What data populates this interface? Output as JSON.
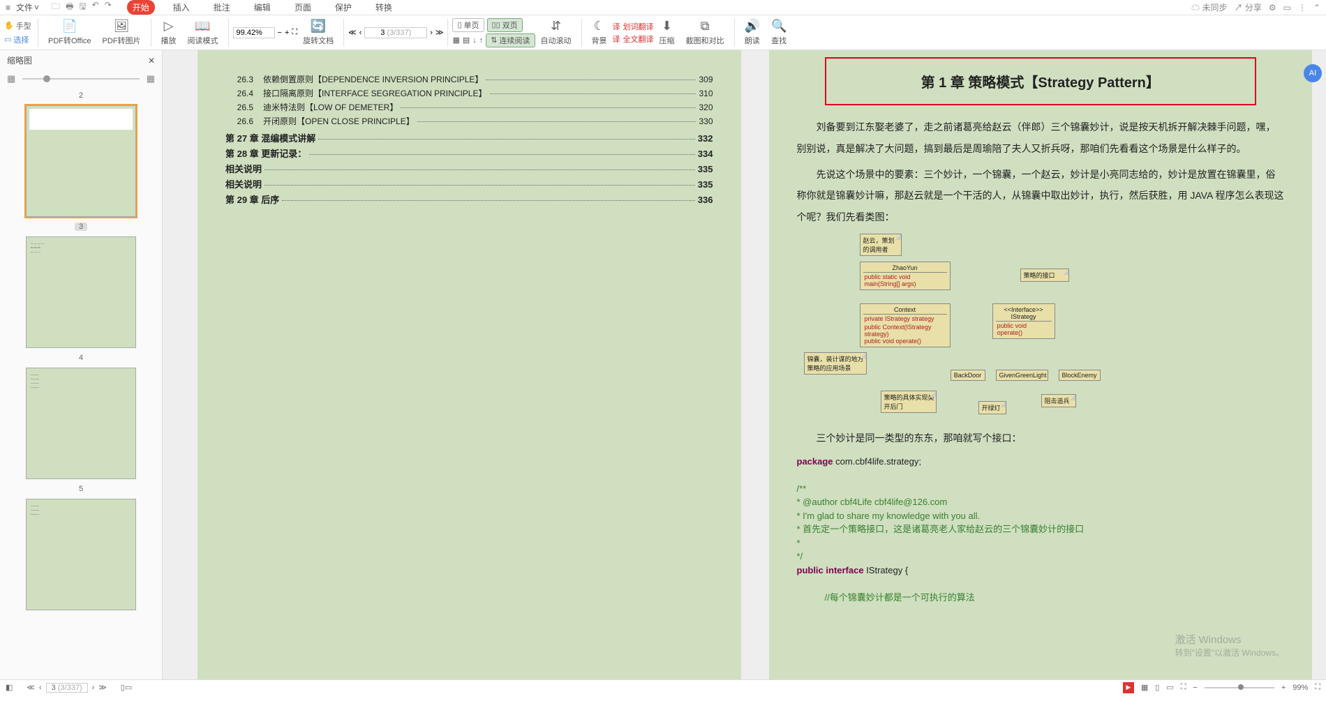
{
  "menu": {
    "file": "文件",
    "tabs": [
      "开始",
      "插入",
      "批注",
      "编辑",
      "页面",
      "保护",
      "转换"
    ],
    "right": {
      "unsync": "未同步",
      "share": "分享"
    }
  },
  "ribbon": {
    "mode_hand": "手型",
    "mode_select": "选择",
    "pdf_office": "PDF转Office",
    "pdf_img": "PDF转图片",
    "play": "播放",
    "read": "阅读模式",
    "zoom": "99.42%",
    "rotate": "旋转文档",
    "page_current": "3",
    "page_total": "(3/337)",
    "single": "单页",
    "double": "双页",
    "continuous": "连续阅读",
    "autoscroll": "自动滚动",
    "bg": "背景",
    "stamp": "全文翻译",
    "wordtrans": "划词翻译",
    "compress": "压缩",
    "screenshot": "截图和对比",
    "read_aloud": "朗读",
    "find": "查找"
  },
  "sidebar": {
    "title": "缩略图",
    "pages": [
      "2",
      "3",
      "4",
      "5"
    ]
  },
  "toc": {
    "items": [
      {
        "num": "26.3",
        "title": "依赖倒置原则【DEPENDENCE INVERSION PRINCIPLE】",
        "page": "309"
      },
      {
        "num": "26.4",
        "title": "接口隔离原则【INTERFACE SEGREGATION PRINCIPLE】",
        "page": "310"
      },
      {
        "num": "26.5",
        "title": "迪米特法则【LOW OF DEMETER】",
        "page": "320"
      },
      {
        "num": "26.6",
        "title": "开闭原则【OPEN CLOSE PRINCIPLE】",
        "page": "330"
      }
    ],
    "chapters": [
      {
        "label": "第 27 章   混编模式讲解",
        "page": "332"
      },
      {
        "label": "第 28 章   更新记录：",
        "page": "334"
      },
      {
        "label": "相关说明",
        "page": "335"
      },
      {
        "label": "相关说明",
        "page": "335"
      },
      {
        "label": "第 29 章   后序",
        "page": "336"
      }
    ]
  },
  "chapter": {
    "title": "第 1 章   策略模式【Strategy Pattern】",
    "p1": "刘备要到江东娶老婆了，走之前诸葛亮给赵云（伴郎）三个锦囊妙计，说是按天机拆开解决棘手问题，嘿，别别说，真是解决了大问题，搞到最后是周瑜陪了夫人又折兵呀，那咱们先看看这个场景是什么样子的。",
    "p2": "先说这个场景中的要素：三个妙计，一个锦囊，一个赵云，妙计是小亮同志给的，妙计是放置在锦囊里，俗称你就是锦囊妙计嘛，那赵云就是一个干活的人，从锦囊中取出妙计，执行，然后获胜，用 JAVA 程序怎么表现这个呢？我们先看类图：",
    "p3": "三个妙计是同一类型的东东，那咱就写个接口：",
    "code": {
      "l1": "package",
      "l1b": " com.cbf4life.strategy;",
      "l2": "/**",
      "l3": " * @author cbf4Life cbf4life@126.com",
      "l4": " * I'm glad to share my knowledge with you all.",
      "l5": " * 首先定一个策略接口，这是诸葛亮老人家给赵云的三个锦囊妙计的接口",
      "l6": " *",
      "l7": " */",
      "l8a": "public interface",
      "l8b": " IStrategy {",
      "l9": "//每个锦囊妙计都是一个可执行的算法"
    }
  },
  "uml": {
    "note1": "赵云，策划的调用者",
    "zhaoyun": "ZhaoYun",
    "zhaoyun_m": "public static void main(String[] args)",
    "context": "Context",
    "context_f": "private IStrategy strategy",
    "context_m1": "public Context(IStrategy strategy)",
    "context_m2": "public void operate()",
    "istrategy": "<<Interface>>\nIStrategy",
    "istrategy_m": "public void operate()",
    "note2": "策略的接口",
    "note3": "锦囊，装计谋的地方\n策略的应用场景",
    "backdoor": "BackDoor",
    "green": "GivenGreenLight",
    "block": "BlockEnemy",
    "note4": "策略的具体实现类\n开后门",
    "note5": "开绿灯",
    "note6": "阻击追兵"
  },
  "status": {
    "page": "3",
    "total": "(3/337)",
    "zoom": "99%"
  },
  "watermark": {
    "l1": "激活 Windows",
    "l2": "转到\"设置\"以激活 Windows。"
  }
}
